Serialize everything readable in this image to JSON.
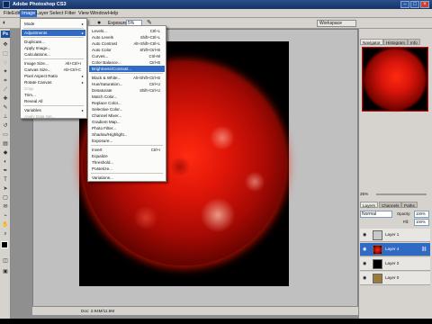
{
  "window": {
    "title": "Adobe Photoshop CS3"
  },
  "menubar": {
    "items": [
      "File",
      "Edit",
      "Image",
      "Layer",
      "Select",
      "Filter",
      "View",
      "Window",
      "Help"
    ],
    "active": "Image"
  },
  "options": {
    "exposure_label": "Exposure:",
    "exposure_value": "5%",
    "workspace_label": "Workspace"
  },
  "image_menu": {
    "items": [
      {
        "label": "Mode",
        "arrow": "▸"
      },
      {
        "label": "Adjustments",
        "arrow": "▸"
      },
      {
        "label": "Duplicate..."
      },
      {
        "label": "Apply Image..."
      },
      {
        "label": "Calculations..."
      },
      {
        "label": "Image Size...",
        "shortcut": "Alt+Ctrl+I"
      },
      {
        "label": "Canvas Size...",
        "shortcut": "Alt+Ctrl+C"
      },
      {
        "label": "Pixel Aspect Ratio",
        "arrow": "▸"
      },
      {
        "label": "Rotate Canvas",
        "arrow": "▸"
      },
      {
        "label": "Crop"
      },
      {
        "label": "Trim..."
      },
      {
        "label": "Reveal All"
      },
      {
        "label": "Variables",
        "arrow": "▸"
      },
      {
        "label": "Apply Data Set..."
      },
      {
        "label": "Trap..."
      }
    ]
  },
  "adjustments_menu": {
    "items": [
      {
        "label": "Levels...",
        "shortcut": "Ctrl+L"
      },
      {
        "label": "Auto Levels",
        "shortcut": "Shift+Ctrl+L"
      },
      {
        "label": "Auto Contrast",
        "shortcut": "Alt+Shift+Ctrl+L"
      },
      {
        "label": "Auto Color",
        "shortcut": "Shift+Ctrl+B"
      },
      {
        "label": "Curves...",
        "shortcut": "Ctrl+M"
      },
      {
        "label": "Color Balance...",
        "shortcut": "Ctrl+B"
      },
      {
        "label": "Brightness/Contrast..."
      },
      {
        "label": "Black & White...",
        "shortcut": "Alt+Shift+Ctrl+B"
      },
      {
        "label": "Hue/Saturation...",
        "shortcut": "Ctrl+U"
      },
      {
        "label": "Desaturate",
        "shortcut": "Shift+Ctrl+U"
      },
      {
        "label": "Match Color..."
      },
      {
        "label": "Replace Color..."
      },
      {
        "label": "Selective Color..."
      },
      {
        "label": "Channel Mixer..."
      },
      {
        "label": "Gradient Map..."
      },
      {
        "label": "Photo Filter..."
      },
      {
        "label": "Shadow/Highlight..."
      },
      {
        "label": "Exposure..."
      },
      {
        "label": "Invert",
        "shortcut": "Ctrl+I"
      },
      {
        "label": "Equalize"
      },
      {
        "label": "Threshold..."
      },
      {
        "label": "Posterize..."
      },
      {
        "label": "Variations..."
      }
    ]
  },
  "navigator": {
    "tabs": [
      "Navigator",
      "Histogram",
      "Info"
    ]
  },
  "layers_panel": {
    "tabs": [
      "Layers",
      "Channels",
      "Paths"
    ],
    "zoom": "25%",
    "blend_mode": "Normal",
    "opacity_label": "Opacity:",
    "opacity_value": "100%",
    "fill_label": "Fill:",
    "fill_value": "100%",
    "layers": [
      {
        "name": "Layer 1",
        "thumb": "#c8c8c8"
      },
      {
        "name": "Layer 4",
        "thumb": "#d01408",
        "selected": true
      },
      {
        "name": "Layer 2",
        "thumb": "#000000"
      },
      {
        "name": "Layer 0",
        "thumb": "#9b7b3c"
      }
    ]
  },
  "status": {
    "doc_info": "Doc: 2.94M/11.6M"
  }
}
